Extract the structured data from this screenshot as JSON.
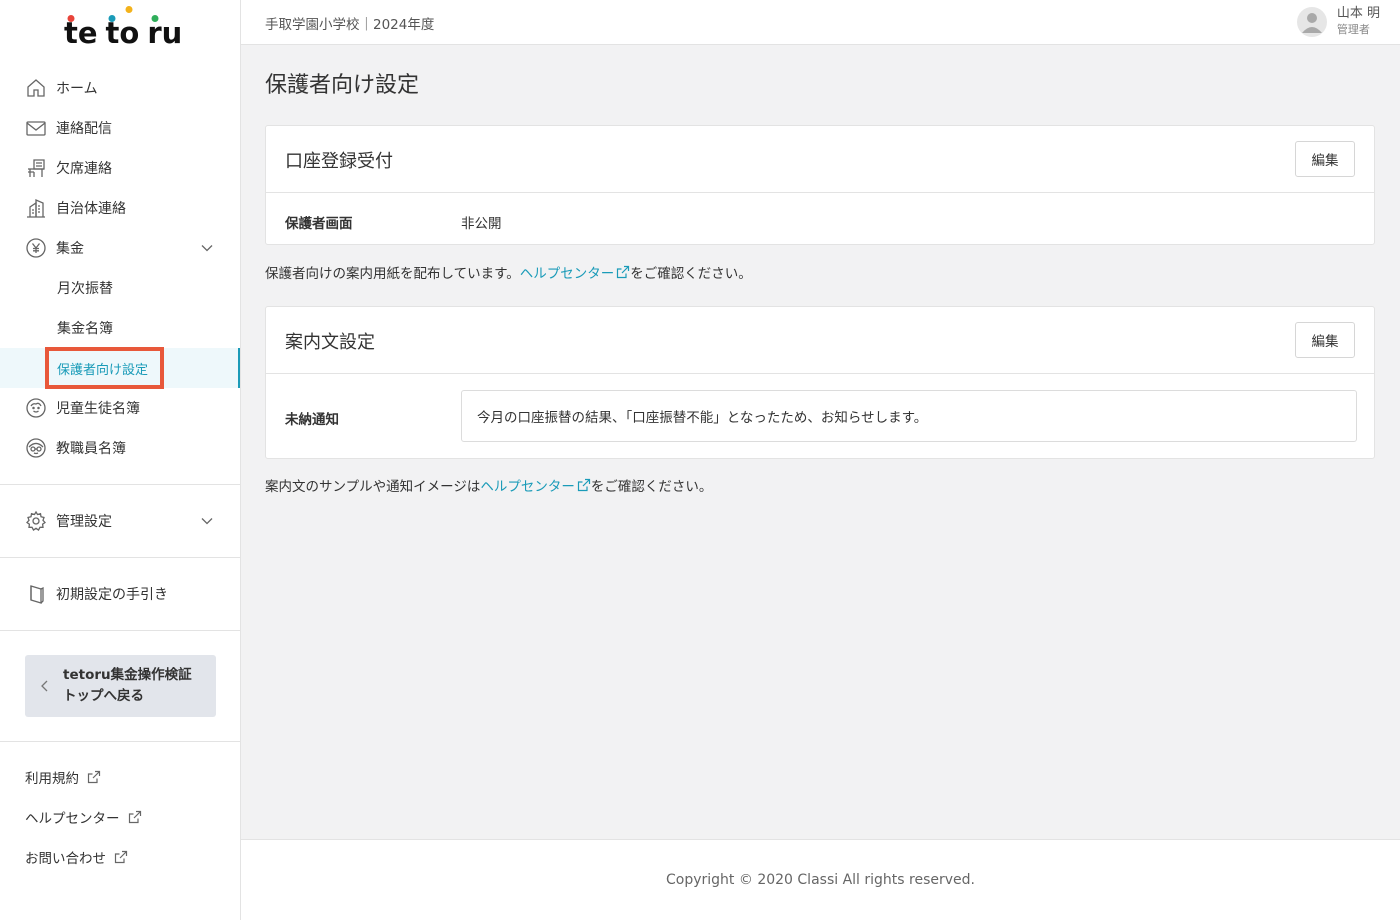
{
  "brand": {
    "logo_letters": [
      "t",
      "e",
      "t",
      "o",
      "r",
      "u"
    ],
    "dot_colors": [
      "#e8443a",
      "#1a9bb8",
      "#f3b21b",
      "#2fae5a"
    ]
  },
  "sidebar": {
    "items": [
      {
        "label": "ホーム",
        "icon": "home-icon"
      },
      {
        "label": "連絡配信",
        "icon": "mail-icon"
      },
      {
        "label": "欠席連絡",
        "icon": "chair-icon"
      },
      {
        "label": "自治体連絡",
        "icon": "building-icon"
      },
      {
        "label": "集金",
        "icon": "yen-icon"
      }
    ],
    "collection_sub": [
      {
        "label": "月次振替"
      },
      {
        "label": "集金名簿"
      },
      {
        "label": "保護者向け設定"
      }
    ],
    "items_after": [
      {
        "label": "児童生徒名簿",
        "icon": "student-icon"
      },
      {
        "label": "教職員名簿",
        "icon": "teacher-icon"
      }
    ],
    "admin": {
      "label": "管理設定",
      "icon": "gear-icon"
    },
    "guide": {
      "label": "初期設定の手引き",
      "icon": "book-icon"
    },
    "back_button": {
      "line1": "tetoru集金操作検証",
      "line2": "トップへ戻る"
    },
    "footer_links": [
      {
        "label": "利用規約"
      },
      {
        "label": "ヘルプセンター"
      },
      {
        "label": "お問い合わせ"
      }
    ]
  },
  "header": {
    "school": "手取学園小学校｜2024年度",
    "user_name": "山本 明",
    "user_role": "管理者"
  },
  "main": {
    "title": "保護者向け設定",
    "account_card": {
      "title": "口座登録受付",
      "edit_label": "編集",
      "row_label": "保護者画面",
      "row_value": "非公開"
    },
    "account_note": {
      "before": "保護者向けの案内用紙を配布しています。",
      "link": "ヘルプセンター",
      "after": "をご確認ください。"
    },
    "notice_card": {
      "title": "案内文設定",
      "edit_label": "編集",
      "row_label": "未納通知",
      "row_value": "今月の口座振替の結果、「口座振替不能」となったため、お知らせします。"
    },
    "notice_note": {
      "before": "案内文のサンプルや通知イメージは",
      "link": "ヘルプセンター",
      "after": "をご確認ください。"
    }
  },
  "footer": {
    "copyright": "Copyright © 2020 Classi All rights reserved."
  },
  "colors": {
    "accent": "#1a9bb8",
    "highlight": "#e8583a"
  }
}
